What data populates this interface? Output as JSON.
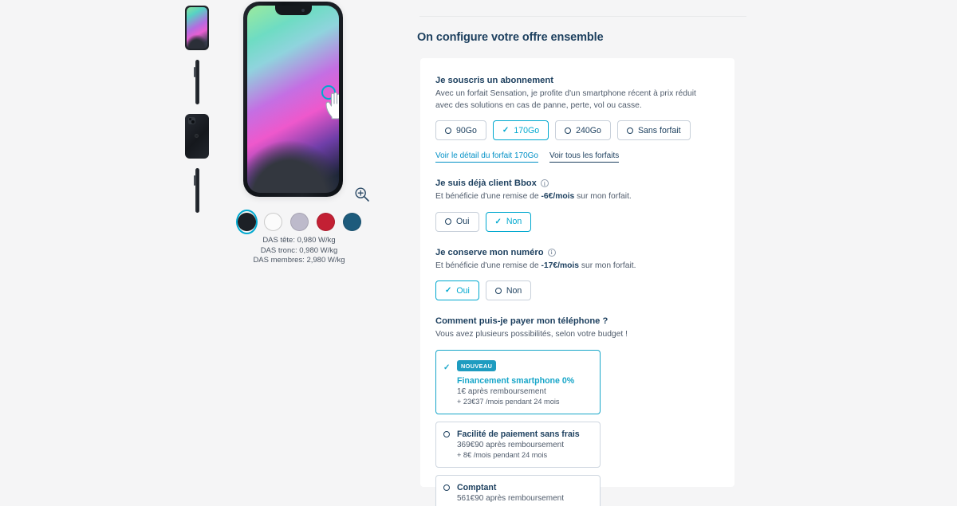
{
  "gallery": {
    "thumbnails": [
      {
        "name": "front-view"
      },
      {
        "name": "side-view-left"
      },
      {
        "name": "back-view"
      },
      {
        "name": "side-view-right"
      }
    ],
    "zoom_icon": "zoom-in-icon",
    "cursor_icon": "hand-pointer-icon",
    "colors": [
      {
        "name": "Noir",
        "hex": "#1c2026",
        "selected": true
      },
      {
        "name": "Blanc",
        "hex": "#fbfbfb",
        "selected": false
      },
      {
        "name": "Mauve",
        "hex": "#bdbacb",
        "selected": false
      },
      {
        "name": "Rouge",
        "hex": "#c32034",
        "selected": false
      },
      {
        "name": "Bleu",
        "hex": "#1d5b7c",
        "selected": false
      }
    ],
    "selection_ring_color": "#00a8cf",
    "das": [
      "DAS tête: 0,980 W/kg",
      "DAS tronc: 0,980 W/kg",
      "DAS membres: 2,980 W/kg"
    ]
  },
  "config": {
    "title": "On configure votre offre ensemble",
    "accent_color": "#00a8cf",
    "text_color": "#1c3f5e",
    "subscription": {
      "title": "Je souscris un abonnement",
      "description": "Avec un forfait Sensation, je profite d'un smartphone récent à prix réduit avec des solutions en cas de panne, perte, vol ou casse.",
      "options": [
        {
          "label": "90Go",
          "selected": false
        },
        {
          "label": "170Go",
          "selected": true
        },
        {
          "label": "240Go",
          "selected": false
        },
        {
          "label": "Sans forfait",
          "selected": false
        }
      ],
      "links": [
        {
          "label": "Voir le détail du forfait 170Go",
          "style": "primary"
        },
        {
          "label": "Voir tous les forfaits",
          "style": "dark"
        }
      ]
    },
    "bbox_client": {
      "title": "Je suis déjà client Bbox",
      "info_icon": "info-circle-icon",
      "description_prefix": "Et bénéficie d'une remise de ",
      "description_amount": "-6€/mois",
      "description_suffix": " sur mon forfait.",
      "options": [
        {
          "label": "Oui",
          "selected": false
        },
        {
          "label": "Non",
          "selected": true
        }
      ]
    },
    "keep_number": {
      "title": "Je conserve mon numéro",
      "info_icon": "info-circle-icon",
      "description_prefix": "Et bénéficie d'une remise de ",
      "description_amount": "-17€/mois",
      "description_suffix": " sur mon forfait.",
      "options": [
        {
          "label": "Oui",
          "selected": true
        },
        {
          "label": "Non",
          "selected": false
        }
      ]
    },
    "payment": {
      "title": "Comment puis-je payer mon téléphone ?",
      "description": "Vous avez plusieurs possibilités, selon votre budget !",
      "options": [
        {
          "badge": "NOUVEAU",
          "title": "Financement smartphone 0%",
          "line1": "1€ après remboursement",
          "line2": "+ 23€37 /mois pendant 24 mois",
          "selected": true
        },
        {
          "badge": null,
          "title": "Facilité de paiement sans frais",
          "line1": "369€90 après remboursement",
          "line2": "+ 8€ /mois pendant 24 mois",
          "selected": false
        },
        {
          "badge": null,
          "title": "Comptant",
          "line1": "561€90 après remboursement",
          "line2": null,
          "selected": false
        }
      ]
    }
  }
}
